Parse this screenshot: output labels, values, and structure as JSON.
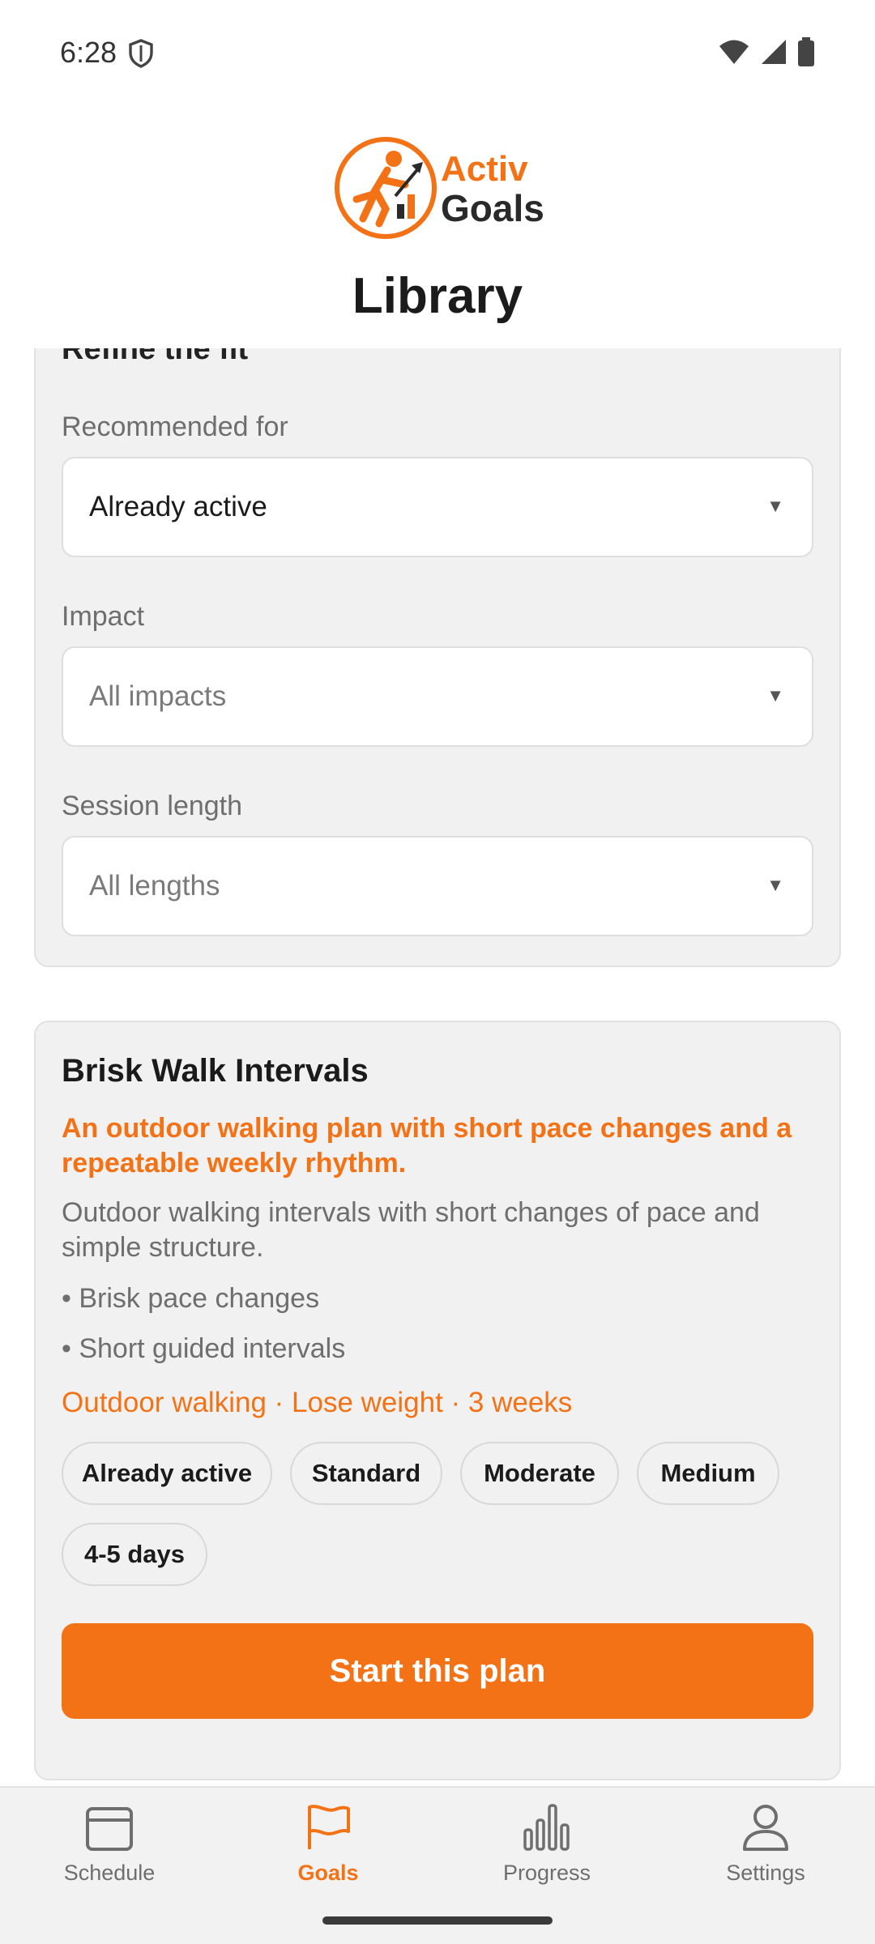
{
  "status_bar": {
    "time": "6:28"
  },
  "header": {
    "logo_line1": "Activ",
    "logo_line2": "Goals",
    "title": "Library"
  },
  "filters": {
    "heading": "Refine the fit",
    "recommended_for": {
      "label": "Recommended for",
      "value": "Already active"
    },
    "impact": {
      "label": "Impact",
      "value": "All impacts"
    },
    "session_length": {
      "label": "Session length",
      "value": "All lengths"
    }
  },
  "plan": {
    "title": "Brisk Walk Intervals",
    "tagline": "An outdoor walking plan with short pace changes and a repeatable weekly rhythm.",
    "description": "Outdoor walking intervals with short changes of pace and simple structure.",
    "bullets": [
      "• Brisk pace changes",
      "• Short guided intervals"
    ],
    "meta": "Outdoor walking · Lose weight · 3 weeks",
    "chips": [
      "Already active",
      "Standard",
      "Moderate",
      "Medium",
      "4-5 days"
    ],
    "cta_label": "Start this plan"
  },
  "nav": {
    "items": [
      {
        "label": "Schedule",
        "icon": "calendar-icon"
      },
      {
        "label": "Goals",
        "icon": "flag-icon",
        "active": true
      },
      {
        "label": "Progress",
        "icon": "bar-chart-icon"
      },
      {
        "label": "Settings",
        "icon": "person-icon"
      }
    ]
  },
  "colors": {
    "accent": "#f47216",
    "card_bg": "#f1f1f1",
    "muted_text": "#6e6e6e"
  }
}
